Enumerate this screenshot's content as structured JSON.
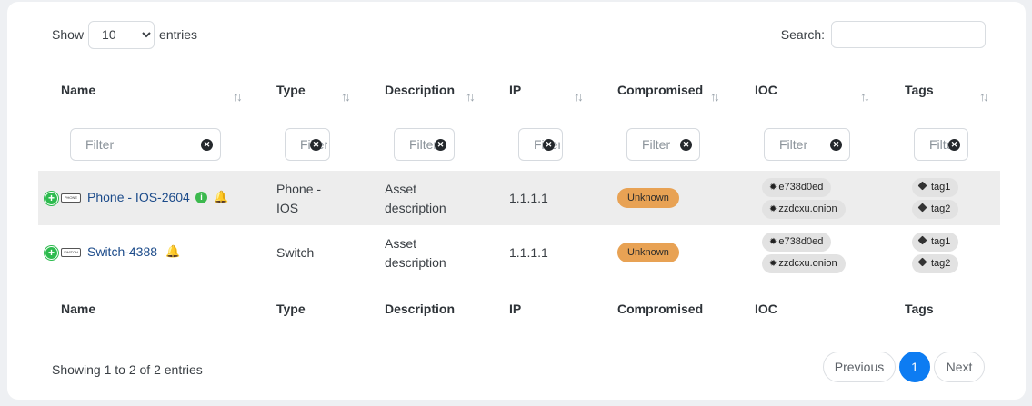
{
  "length_menu": {
    "show_label": "Show",
    "value": "10",
    "entries_label": "entries",
    "options": [
      "10"
    ]
  },
  "search": {
    "label": "Search:",
    "value": ""
  },
  "columns": [
    "Name",
    "Type",
    "Description",
    "IP",
    "Compromised",
    "IOC",
    "Tags"
  ],
  "filters": {
    "placeholder": "Filter",
    "clear_icon": "x-circle-icon"
  },
  "rows": [
    {
      "name": "Phone - IOS-2604",
      "device_icon_text": "PHONE",
      "type": "Phone - IOS",
      "description": "Asset description",
      "ip": "1.1.1.1",
      "compromised": "Unknown",
      "ioc": [
        "e738d0ed",
        "zzdcxu.onion"
      ],
      "tags": [
        "tag1",
        "tag2"
      ]
    },
    {
      "name": "Switch-4388",
      "device_icon_text": "SWITCH",
      "type": "Switch",
      "description": "Asset description",
      "ip": "1.1.1.1",
      "compromised": "Unknown",
      "ioc": [
        "e738d0ed",
        "zzdcxu.onion"
      ],
      "tags": [
        "tag1",
        "tag2"
      ]
    }
  ],
  "summary": "Showing 1 to 2 of 2 entries",
  "pagination": {
    "previous": "Previous",
    "page": "1",
    "next": "Next"
  },
  "colors": {
    "accent": "#0d7cf2",
    "link": "#1c4b8a",
    "badge": "#e8a254",
    "plus": "#2dbb4e",
    "bell": "#f0a41f"
  }
}
